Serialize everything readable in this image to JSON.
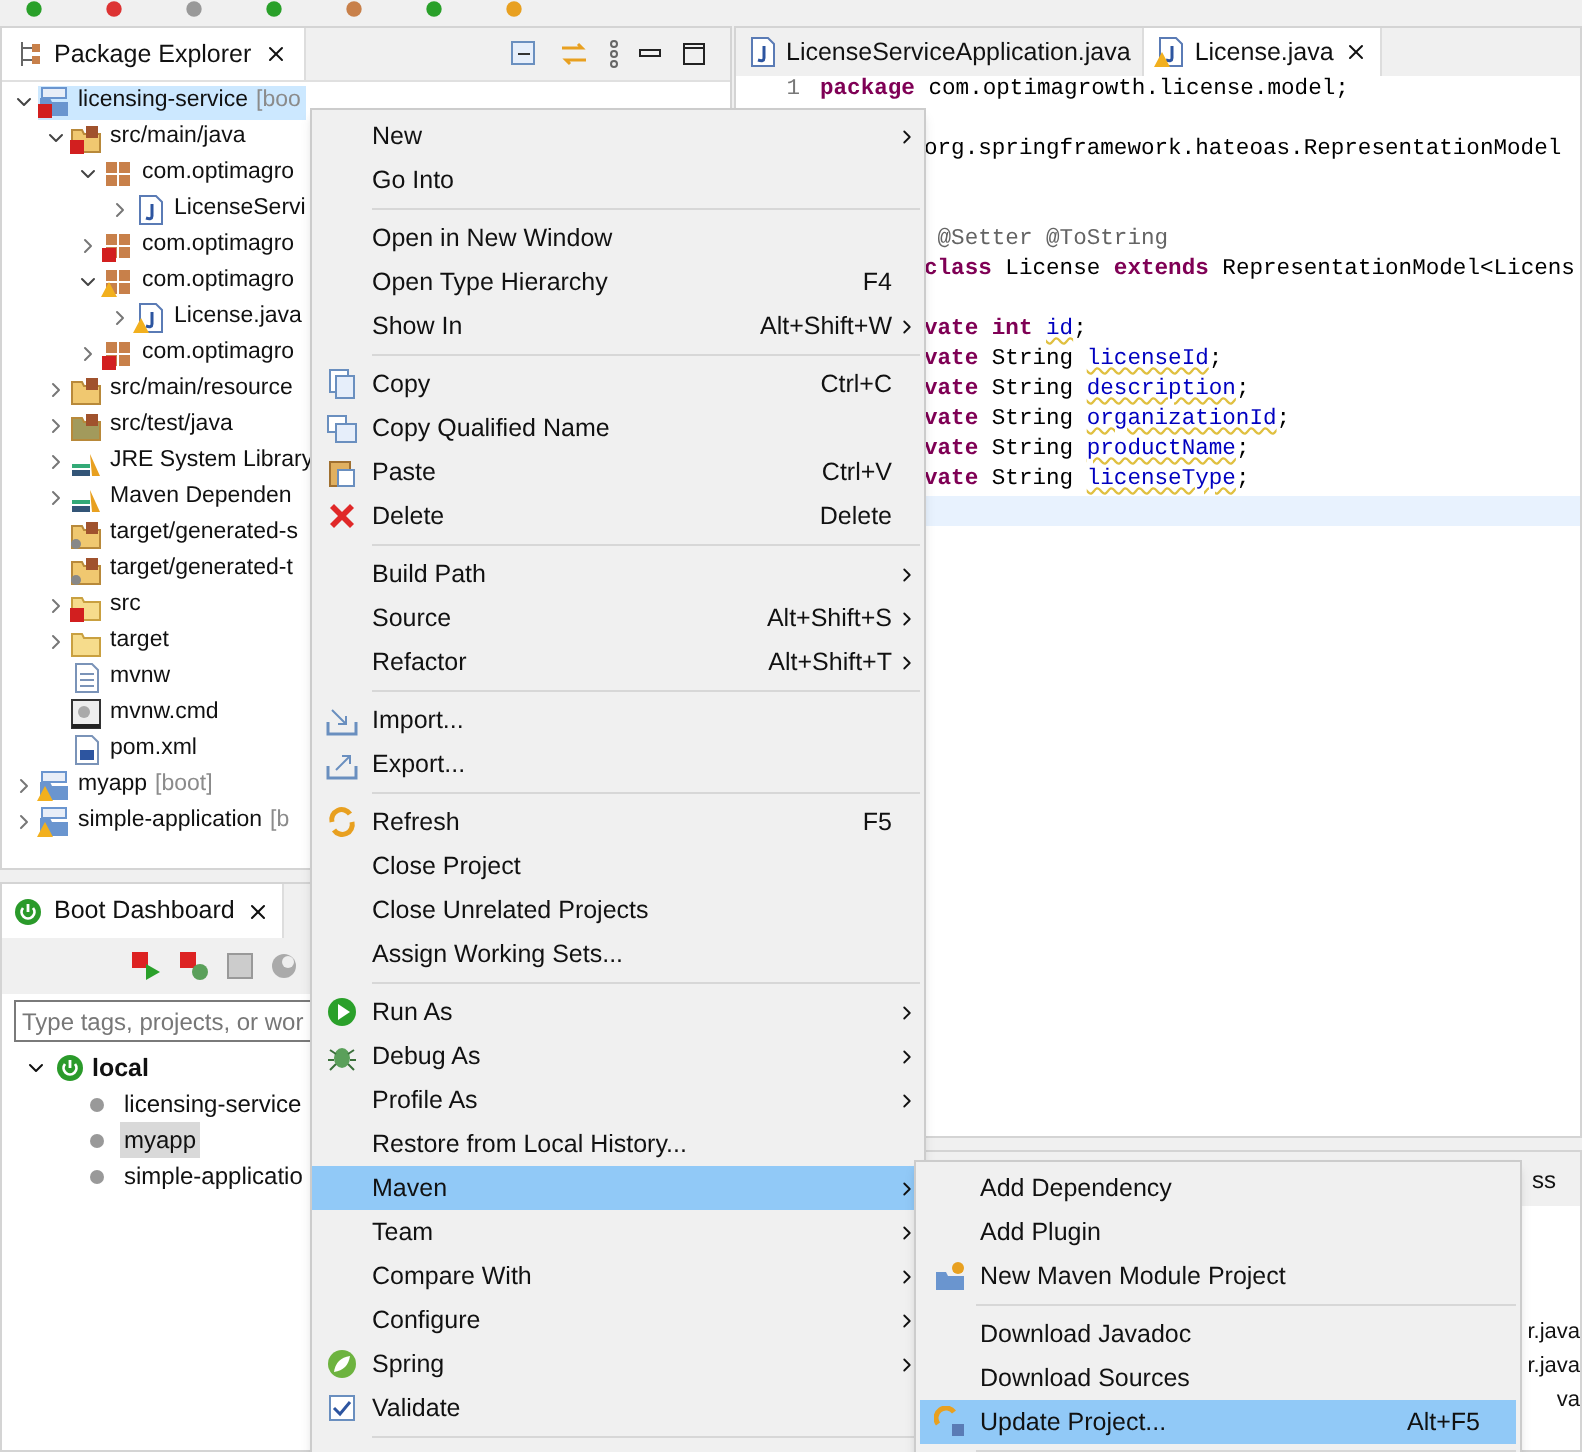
{
  "package_explorer": {
    "title": "Package Explorer",
    "tree": [
      {
        "label": "licensing-service",
        "suffix": "[boo",
        "kind": "project",
        "error": true,
        "warning": false,
        "expanded": true,
        "selected": true,
        "children": [
          {
            "label": "src/main/java",
            "kind": "source-folder",
            "error": true,
            "warning": false,
            "expanded": true,
            "selected": false,
            "children": [
              {
                "label": "com.optimagro",
                "kind": "package",
                "error": false,
                "warning": false,
                "expanded": true,
                "selected": false,
                "children": [
                  {
                    "label": "LicenseServi",
                    "kind": "java",
                    "error": false,
                    "warning": false,
                    "expanded": false,
                    "selected": false
                  }
                ]
              },
              {
                "label": "com.optimagro",
                "kind": "package",
                "error": true,
                "warning": false,
                "expanded": false,
                "selected": false
              },
              {
                "label": "com.optimagro",
                "kind": "package",
                "error": false,
                "warning": true,
                "expanded": true,
                "selected": false,
                "children": [
                  {
                    "label": "License.java",
                    "kind": "java",
                    "error": false,
                    "warning": true,
                    "expanded": false,
                    "selected": false
                  }
                ]
              },
              {
                "label": "com.optimagro",
                "kind": "package",
                "error": true,
                "warning": false,
                "expanded": false,
                "selected": false
              }
            ]
          },
          {
            "label": "src/main/resource",
            "kind": "resource-folder",
            "error": false,
            "warning": false,
            "expanded": false,
            "selected": false
          },
          {
            "label": "src/test/java",
            "kind": "test-folder",
            "error": false,
            "warning": false,
            "expanded": false,
            "selected": false
          },
          {
            "label": "JRE System Library",
            "kind": "library",
            "error": false,
            "warning": false,
            "expanded": false,
            "selected": false
          },
          {
            "label": "Maven Dependen",
            "kind": "library",
            "error": false,
            "warning": false,
            "expanded": false,
            "selected": false
          },
          {
            "label": "target/generated-s",
            "kind": "generated-folder",
            "error": false,
            "warning": false,
            "selected": false
          },
          {
            "label": "target/generated-t",
            "kind": "generated-folder",
            "error": false,
            "warning": false,
            "selected": false
          },
          {
            "label": "src",
            "kind": "folder",
            "error": true,
            "warning": false,
            "expanded": false,
            "selected": false
          },
          {
            "label": "target",
            "kind": "folder",
            "error": false,
            "warning": false,
            "expanded": false,
            "selected": false
          },
          {
            "label": "mvnw",
            "kind": "file",
            "error": false,
            "warning": false,
            "selected": false
          },
          {
            "label": "mvnw.cmd",
            "kind": "cmd",
            "error": false,
            "warning": false,
            "selected": false
          },
          {
            "label": "pom.xml",
            "kind": "pom",
            "error": false,
            "warning": false,
            "selected": false
          }
        ]
      },
      {
        "label": "myapp",
        "suffix": "[boot]",
        "kind": "project",
        "error": false,
        "warning": true,
        "expanded": false,
        "selected": false
      },
      {
        "label": "simple-application",
        "suffix": "[b",
        "kind": "project",
        "error": false,
        "warning": true,
        "expanded": false,
        "selected": false
      }
    ]
  },
  "boot_dashboard": {
    "title": "Boot Dashboard",
    "search": {
      "placeholder": "Type tags, projects, or wor"
    },
    "tree": [
      {
        "label": "local",
        "expanded": true,
        "children": [
          {
            "label": "licensing-service",
            "selected": false
          },
          {
            "label": "myapp",
            "selected": true
          },
          {
            "label": "simple-applicatio",
            "selected": false
          }
        ]
      }
    ]
  },
  "editor": {
    "tabs": [
      {
        "title": "LicenseServiceApplication.java",
        "selected": false,
        "warning": false
      },
      {
        "title": "License.java",
        "selected": true,
        "warning": true
      }
    ],
    "lines": [
      {
        "kind": "full",
        "number": "1",
        "tokens": [
          {
            "kind": "keyword",
            "text": "package"
          },
          {
            "kind": "plain",
            "text": " com.optimagrowth.license.model;"
          }
        ]
      },
      {
        "kind": "blank"
      },
      {
        "kind": "clipped",
        "tokens": [
          {
            "kind": "plain",
            "text": "org.springframework.hateoas.RepresentationModel"
          }
        ]
      },
      {
        "kind": "blank"
      },
      {
        "kind": "blank"
      },
      {
        "kind": "clipped",
        "tokens": [
          {
            "kind": "annotation",
            "text": " @Setter @ToString"
          }
        ]
      },
      {
        "kind": "clipped",
        "tokens": [
          {
            "kind": "keyword",
            "text": "class"
          },
          {
            "kind": "plain",
            "text": " License "
          },
          {
            "kind": "keyword",
            "text": "extends"
          },
          {
            "kind": "plain",
            "text": " RepresentationModel<Licens"
          }
        ]
      },
      {
        "kind": "blank"
      },
      {
        "kind": "clipped",
        "tokens": [
          {
            "kind": "keyword",
            "text": "vate int"
          },
          {
            "kind": "field",
            "text": "id"
          },
          {
            "kind": "plain",
            "text": ";"
          }
        ]
      },
      {
        "kind": "clipped",
        "tokens": [
          {
            "kind": "keyword",
            "text": "vate"
          },
          {
            "kind": "plain",
            "text": " String "
          },
          {
            "kind": "field",
            "text": "licenseId"
          },
          {
            "kind": "plain",
            "text": ";"
          }
        ]
      },
      {
        "kind": "clipped",
        "tokens": [
          {
            "kind": "keyword",
            "text": "vate"
          },
          {
            "kind": "plain",
            "text": " String "
          },
          {
            "kind": "field",
            "text": "description"
          },
          {
            "kind": "plain",
            "text": ";"
          }
        ]
      },
      {
        "kind": "clipped",
        "tokens": [
          {
            "kind": "keyword",
            "text": "vate"
          },
          {
            "kind": "plain",
            "text": " String "
          },
          {
            "kind": "field",
            "text": "organizationId"
          },
          {
            "kind": "plain",
            "text": ";"
          }
        ]
      },
      {
        "kind": "clipped",
        "tokens": [
          {
            "kind": "keyword",
            "text": "vate"
          },
          {
            "kind": "plain",
            "text": " String "
          },
          {
            "kind": "field",
            "text": "productName"
          },
          {
            "kind": "plain",
            "text": ";"
          }
        ]
      },
      {
        "kind": "clipped",
        "tokens": [
          {
            "kind": "keyword",
            "text": "vate"
          },
          {
            "kind": "plain",
            "text": " String "
          },
          {
            "kind": "field",
            "text": "licenseType"
          },
          {
            "kind": "plain",
            "text": ";"
          }
        ]
      },
      {
        "kind": "current"
      }
    ]
  },
  "bottom_panel": {
    "tab": "ss",
    "rows": [
      "r.java",
      "r.java",
      "va"
    ]
  },
  "context_menu": {
    "items": [
      {
        "kind": "item",
        "label": "New",
        "submenu": true,
        "selected": false
      },
      {
        "kind": "item",
        "label": "Go Into",
        "submenu": false,
        "selected": false
      },
      {
        "kind": "separator"
      },
      {
        "kind": "item",
        "label": "Open in New Window",
        "submenu": false,
        "selected": false
      },
      {
        "kind": "item",
        "label": "Open Type Hierarchy",
        "shortcut": "F4",
        "submenu": false,
        "selected": false
      },
      {
        "kind": "item",
        "label": "Show In",
        "shortcut": "Alt+Shift+W",
        "submenu": true,
        "selected": false
      },
      {
        "kind": "separator"
      },
      {
        "kind": "item",
        "label": "Copy",
        "shortcut": "Ctrl+C",
        "submenu": false,
        "selected": false
      },
      {
        "kind": "item",
        "label": "Copy Qualified Name",
        "submenu": false,
        "selected": false
      },
      {
        "kind": "item",
        "label": "Paste",
        "shortcut": "Ctrl+V",
        "submenu": false,
        "selected": false
      },
      {
        "kind": "item",
        "label": "Delete",
        "shortcut": "Delete",
        "submenu": false,
        "selected": false
      },
      {
        "kind": "separator"
      },
      {
        "kind": "item",
        "label": "Build Path",
        "submenu": true,
        "selected": false
      },
      {
        "kind": "item",
        "label": "Source",
        "shortcut": "Alt+Shift+S",
        "submenu": true,
        "selected": false
      },
      {
        "kind": "item",
        "label": "Refactor",
        "shortcut": "Alt+Shift+T",
        "submenu": true,
        "selected": false
      },
      {
        "kind": "separator"
      },
      {
        "kind": "item",
        "label": "Import...",
        "submenu": false,
        "selected": false
      },
      {
        "kind": "item",
        "label": "Export...",
        "submenu": false,
        "selected": false
      },
      {
        "kind": "separator"
      },
      {
        "kind": "item",
        "label": "Refresh",
        "shortcut": "F5",
        "submenu": false,
        "selected": false
      },
      {
        "kind": "item",
        "label": "Close Project",
        "submenu": false,
        "selected": false
      },
      {
        "kind": "item",
        "label": "Close Unrelated Projects",
        "submenu": false,
        "selected": false
      },
      {
        "kind": "item",
        "label": "Assign Working Sets...",
        "submenu": false,
        "selected": false
      },
      {
        "kind": "separator"
      },
      {
        "kind": "item",
        "label": "Run As",
        "submenu": true,
        "selected": false
      },
      {
        "kind": "item",
        "label": "Debug As",
        "submenu": true,
        "selected": false
      },
      {
        "kind": "item",
        "label": "Profile As",
        "submenu": true,
        "selected": false
      },
      {
        "kind": "item",
        "label": "Restore from Local History...",
        "submenu": false,
        "selected": false
      },
      {
        "kind": "item",
        "label": "Maven",
        "submenu": true,
        "selected": true
      },
      {
        "kind": "item",
        "label": "Team",
        "submenu": true,
        "selected": false
      },
      {
        "kind": "item",
        "label": "Compare With",
        "submenu": true,
        "selected": false
      },
      {
        "kind": "item",
        "label": "Configure",
        "submenu": true,
        "selected": false
      },
      {
        "kind": "item",
        "label": "Spring",
        "submenu": true,
        "selected": false
      },
      {
        "kind": "item",
        "label": "Validate",
        "submenu": false,
        "selected": false
      },
      {
        "kind": "separator"
      }
    ]
  },
  "maven_submenu": {
    "items": [
      {
        "kind": "item",
        "label": "Add Dependency",
        "selected": false
      },
      {
        "kind": "item",
        "label": "Add Plugin",
        "selected": false
      },
      {
        "kind": "item",
        "label": "New Maven Module Project",
        "selected": false
      },
      {
        "kind": "separator"
      },
      {
        "kind": "item",
        "label": "Download Javadoc",
        "selected": false
      },
      {
        "kind": "item",
        "label": "Download Sources",
        "selected": false
      },
      {
        "kind": "item",
        "label": "Update Project...",
        "shortcut": "Alt+F5",
        "selected": true
      },
      {
        "kind": "separator"
      }
    ]
  }
}
